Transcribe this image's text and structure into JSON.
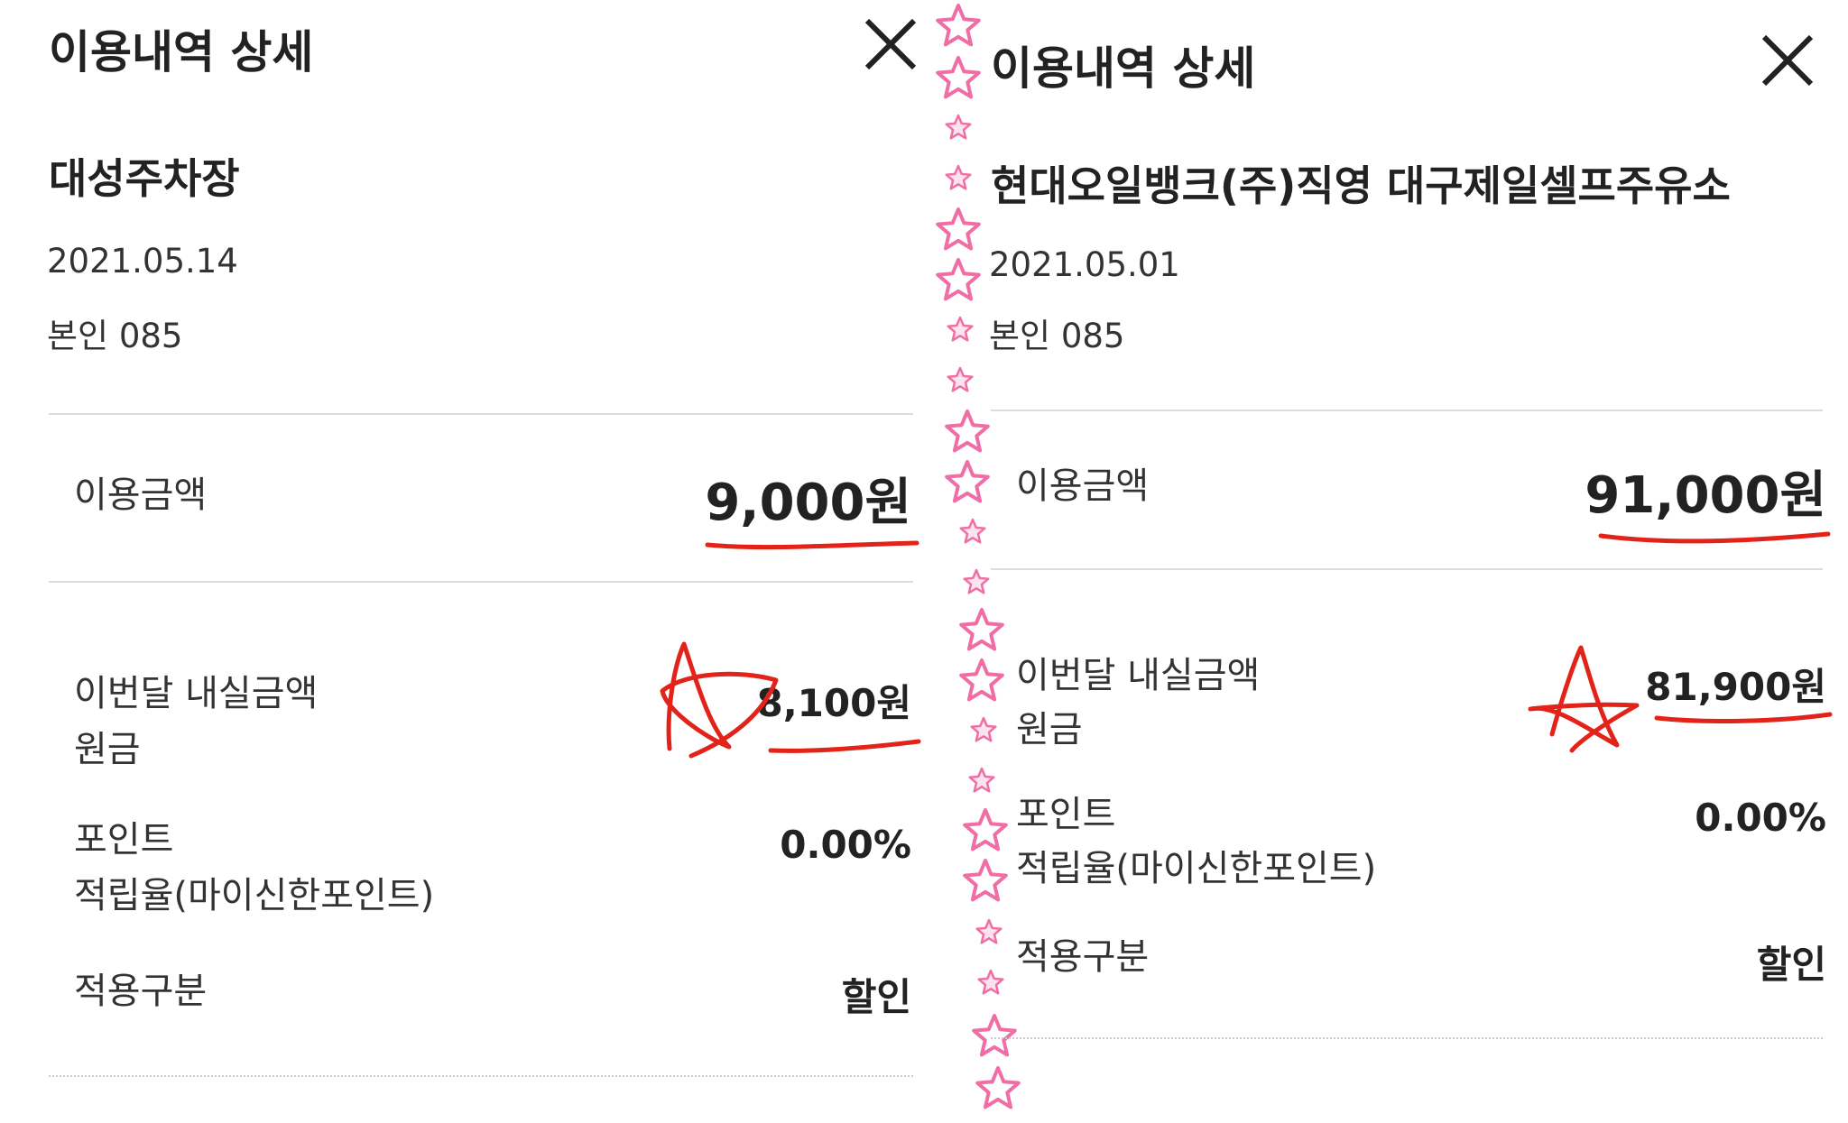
{
  "colors": {
    "annotation_red": "#e2231a",
    "star_pink": "#f06ea5",
    "text": "#222222",
    "divider": "#dcdcdc"
  },
  "left": {
    "header": {
      "title": "이용내역 상세",
      "close_icon": "close-icon"
    },
    "merchant": "대성주차장",
    "date": "2021.05.14",
    "card": "본인 085",
    "amount": {
      "label": "이용금액",
      "value": "9,000원"
    },
    "monthly": {
      "label_line1": "이번달 내실금액",
      "label_line2": "원금",
      "value": "8,100원"
    },
    "point": {
      "label_line1": "포인트",
      "label_line2": "적립율(마이신한포인트)",
      "value": "0.00%"
    },
    "type": {
      "label": "적용구분",
      "value": "할인"
    }
  },
  "right": {
    "header": {
      "title": "이용내역 상세",
      "close_icon": "close-icon"
    },
    "merchant": "현대오일뱅크(주)직영 대구제일셀프주유소",
    "date": "2021.05.01",
    "card": "본인 085",
    "amount": {
      "label": "이용금액",
      "value": "91,000원"
    },
    "monthly": {
      "label_line1": "이번달 내실금액",
      "label_line2": "원금",
      "value": "81,900원"
    },
    "point": {
      "label_line1": "포인트",
      "label_line2": "적립율(마이신한포인트)",
      "value": "0.00%"
    },
    "type": {
      "label": "적용구분",
      "value": "할인"
    }
  },
  "decorations": {
    "star_border_icon": "star-icon",
    "annotation_star_icon": "hand-drawn-star-icon"
  }
}
